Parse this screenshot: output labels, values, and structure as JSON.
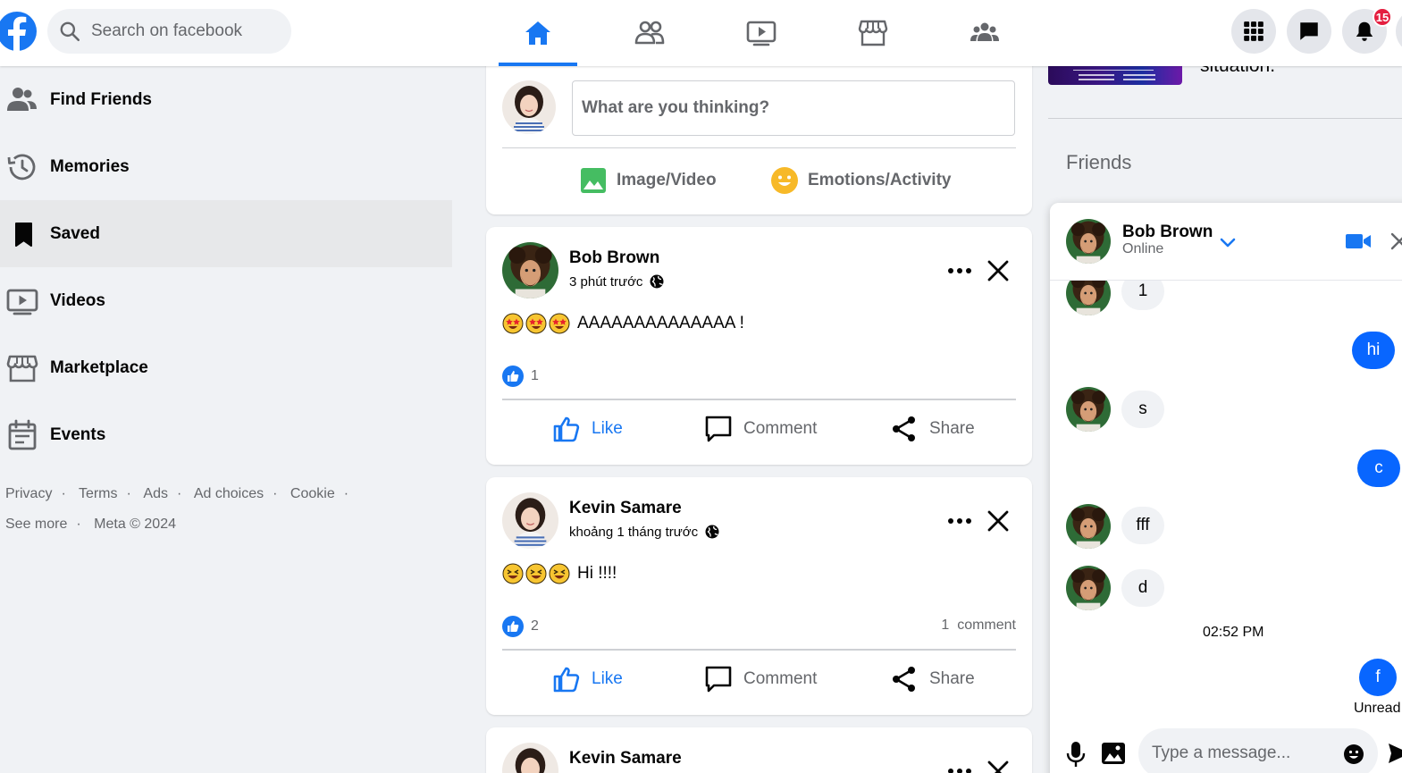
{
  "brand": {
    "accent": "#1877f2",
    "badge_red": "#e41e3f",
    "bubble_blue": "#0866ff"
  },
  "search": {
    "placeholder": "Search on facebook",
    "icon": "search-icon"
  },
  "nav_tabs": [
    {
      "name": "home",
      "icon": "home-icon",
      "active": true
    },
    {
      "name": "friends",
      "icon": "friends-icon",
      "active": false
    },
    {
      "name": "watch",
      "icon": "watch-icon",
      "active": false
    },
    {
      "name": "marketplace",
      "icon": "marketplace-icon",
      "active": false
    },
    {
      "name": "groups",
      "icon": "groups-icon",
      "active": false
    }
  ],
  "header_right": {
    "notifications_count": "15"
  },
  "sidebar": {
    "items": [
      {
        "label": "Find Friends",
        "icon": "friends-icon"
      },
      {
        "label": "Memories",
        "icon": "history-icon"
      },
      {
        "label": "Saved",
        "icon": "bookmark-icon",
        "active": true
      },
      {
        "label": "Videos",
        "icon": "video-icon"
      },
      {
        "label": "Marketplace",
        "icon": "store-icon"
      },
      {
        "label": "Events",
        "icon": "calendar-icon"
      }
    ],
    "footer": {
      "privacy": "Privacy",
      "terms": "Terms",
      "ads": "Ads",
      "ad_choices": "Ad choices",
      "cookie": "Cookie",
      "see_more": "See more",
      "meta": "Meta © 2024"
    }
  },
  "composer": {
    "prompt": "What are you thinking?",
    "image_video": "Image/Video",
    "emotions": "Emotions/Activity"
  },
  "posts": [
    {
      "author": "Bob Brown",
      "time": "3 phút trước",
      "emoji_count": 3,
      "emoji": "star-struck",
      "text": "AAAAAAAAAAAAAA !",
      "likes": "1",
      "comments": "",
      "like_label": "Like",
      "comment_label": "Comment",
      "share_label": "Share"
    },
    {
      "author": "Kevin Samare",
      "time": "khoảng 1 tháng trước",
      "emoji_count": 3,
      "emoji": "laughing",
      "text": "Hi !!!!",
      "likes": "2",
      "comments": "1  comment",
      "like_label": "Like",
      "comment_label": "Comment",
      "share_label": "Share"
    },
    {
      "author": "Kevin Samare"
    }
  ],
  "right": {
    "ad_caption": "situation.",
    "friends_title": "Friends"
  },
  "chat": {
    "name": "Bob Brown",
    "status": "Online",
    "messages": [
      {
        "dir": "in",
        "text": "1"
      },
      {
        "dir": "out",
        "text": "hi"
      },
      {
        "dir": "in",
        "text": "s"
      },
      {
        "dir": "out",
        "text": "c"
      },
      {
        "dir": "in",
        "text": "fff"
      },
      {
        "dir": "in",
        "text": "d"
      },
      {
        "dir": "out",
        "text": "f"
      }
    ],
    "time": "02:52 PM",
    "unread": "Unread",
    "input_placeholder": "Type a message..."
  }
}
